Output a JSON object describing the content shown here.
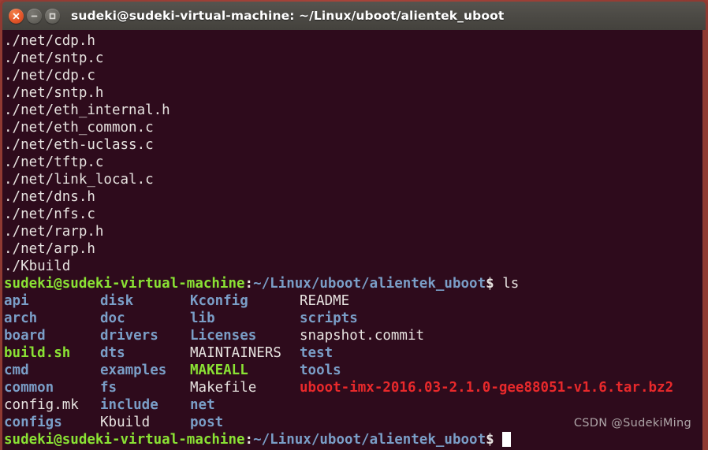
{
  "window": {
    "title": "sudeki@sudeki-virtual-machine: ~/Linux/uboot/alientek_uboot",
    "controls": {
      "close_label": "close-button",
      "minimize_label": "minimize-button",
      "maximize_label": "maximize-button"
    },
    "colors": {
      "frame": "#9e3b33",
      "titlebar": "#4b4944",
      "terminal_bg": "#2e0b1c",
      "text_white": "#e7e3e0",
      "dir_blue": "#7a9ec7",
      "exec_green": "#8ae234",
      "archive_red": "#e8292b"
    }
  },
  "terminal": {
    "find_output_lines": [
      "./net/cdp.h",
      "./net/sntp.c",
      "./net/cdp.c",
      "./net/sntp.h",
      "./net/eth_internal.h",
      "./net/eth_common.c",
      "./net/eth-uclass.c",
      "./net/tftp.c",
      "./net/link_local.c",
      "./net/dns.h",
      "./net/nfs.c",
      "./net/rarp.h",
      "./net/arp.h",
      "./Kbuild"
    ],
    "prompt": {
      "user_host": "sudeki@sudeki-virtual-machine",
      "separator": ":",
      "path": "~/Linux/uboot/alientek_uboot",
      "dollar": "$"
    },
    "command": "ls",
    "ls_rows": [
      [
        {
          "name": "api",
          "type": "dir"
        },
        {
          "name": "disk",
          "type": "dir"
        },
        {
          "name": "Kconfig",
          "type": "dir"
        },
        {
          "name": "README",
          "type": "file"
        }
      ],
      [
        {
          "name": "arch",
          "type": "dir"
        },
        {
          "name": "doc",
          "type": "dir"
        },
        {
          "name": "lib",
          "type": "dir"
        },
        {
          "name": "scripts",
          "type": "dir"
        }
      ],
      [
        {
          "name": "board",
          "type": "dir"
        },
        {
          "name": "drivers",
          "type": "dir"
        },
        {
          "name": "Licenses",
          "type": "dir"
        },
        {
          "name": "snapshot.commit",
          "type": "file"
        }
      ],
      [
        {
          "name": "build.sh",
          "type": "exec"
        },
        {
          "name": "dts",
          "type": "dir"
        },
        {
          "name": "MAINTAINERS",
          "type": "file"
        },
        {
          "name": "test",
          "type": "dir"
        }
      ],
      [
        {
          "name": "cmd",
          "type": "dir"
        },
        {
          "name": "examples",
          "type": "dir"
        },
        {
          "name": "MAKEALL",
          "type": "exec"
        },
        {
          "name": "tools",
          "type": "dir"
        }
      ],
      [
        {
          "name": "common",
          "type": "dir"
        },
        {
          "name": "fs",
          "type": "dir"
        },
        {
          "name": "Makefile",
          "type": "file"
        },
        {
          "name": "uboot-imx-2016.03-2.1.0-gee88051-v1.6.tar.bz2",
          "type": "archive"
        }
      ],
      [
        {
          "name": "config.mk",
          "type": "file"
        },
        {
          "name": "include",
          "type": "dir"
        },
        {
          "name": "net",
          "type": "dir"
        },
        {
          "name": "",
          "type": "file"
        }
      ],
      [
        {
          "name": "configs",
          "type": "dir"
        },
        {
          "name": "Kbuild",
          "type": "file"
        },
        {
          "name": "post",
          "type": "dir"
        },
        {
          "name": "",
          "type": "file"
        }
      ]
    ],
    "column_offsets": [
      0,
      122,
      236,
      375
    ],
    "watermark": "CSDN @SudekiMing"
  }
}
